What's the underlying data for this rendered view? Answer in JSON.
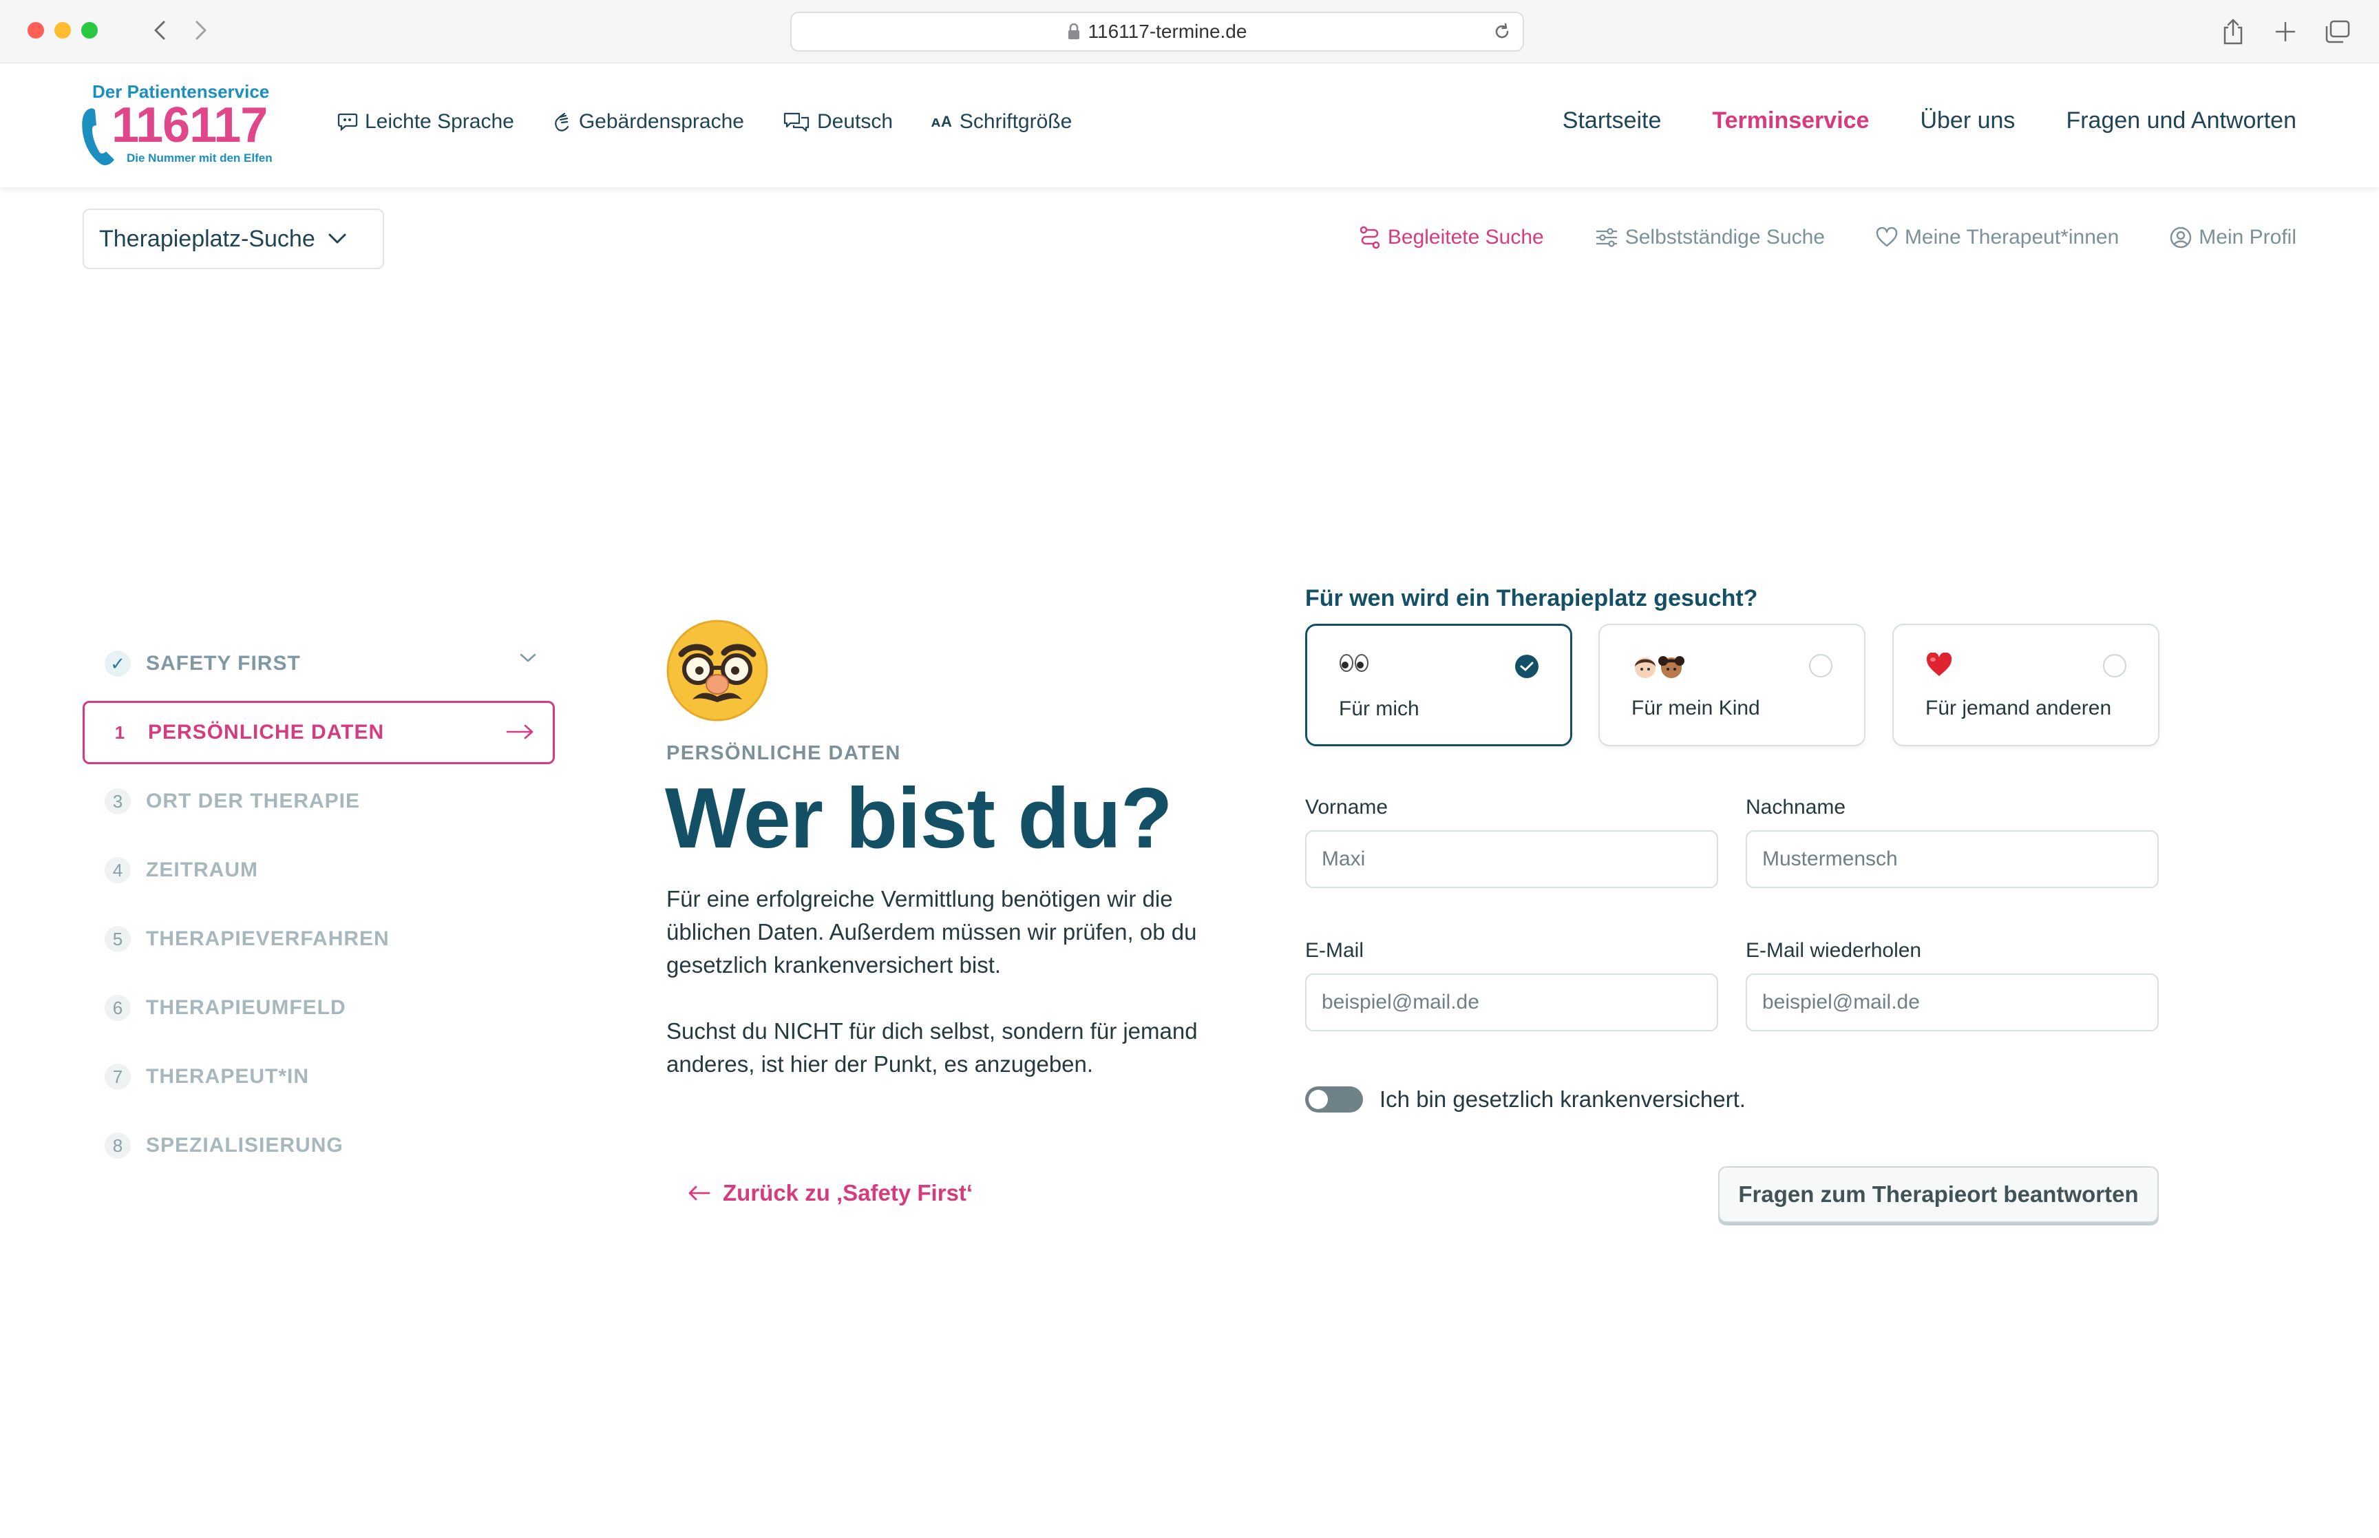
{
  "browser": {
    "url": "116117-termine.de"
  },
  "logo": {
    "top_text": "Der Patientenservice",
    "number": "116117",
    "tagline": "Die Nummer mit den Elfen"
  },
  "access_links": [
    {
      "label": "Leichte Sprache",
      "icon": "speech-bubble-icon"
    },
    {
      "label": "Gebärdensprache",
      "icon": "hand-sign-icon"
    },
    {
      "label": "Deutsch",
      "icon": "language-bubbles-icon"
    },
    {
      "label": "Schriftgröße",
      "icon": "font-size-icon"
    }
  ],
  "main_nav": [
    {
      "label": "Startseite",
      "active": false
    },
    {
      "label": "Terminservice",
      "active": true
    },
    {
      "label": "Über uns",
      "active": false
    },
    {
      "label": "Fragen und Antworten",
      "active": false
    }
  ],
  "sub_select": {
    "label": "Therapieplatz-Suche"
  },
  "sub_nav": [
    {
      "label": "Begleitete Suche",
      "icon": "route-icon",
      "active": true
    },
    {
      "label": "Selbstständige Suche",
      "icon": "sliders-icon",
      "active": false
    },
    {
      "label": "Meine Therapeut*innen",
      "icon": "heart-icon",
      "active": false
    },
    {
      "label": "Mein Profil",
      "icon": "user-circle-icon",
      "active": false
    }
  ],
  "steps": [
    {
      "num": "✓",
      "label": "SAFETY FIRST",
      "state": "done"
    },
    {
      "num": "1",
      "label": "PERSÖNLICHE DATEN",
      "state": "current"
    },
    {
      "num": "3",
      "label": "ORT DER THERAPIE",
      "state": "todo"
    },
    {
      "num": "4",
      "label": "ZEITRAUM",
      "state": "todo"
    },
    {
      "num": "5",
      "label": "THERAPIEVERFAHREN",
      "state": "todo"
    },
    {
      "num": "6",
      "label": "THERAPIEUMFELD",
      "state": "todo"
    },
    {
      "num": "7",
      "label": "THERAPEUT*IN",
      "state": "todo"
    },
    {
      "num": "8",
      "label": "SPEZIALISIERUNG",
      "state": "todo"
    }
  ],
  "content": {
    "emoji": "disguised-face",
    "eyebrow": "PERSÖNLICHE DATEN",
    "headline": "Wer bist du?",
    "paragraph1": "Für eine erfolgreiche Vermittlung benötigen wir die üblichen Daten. Außerdem müssen wir prüfen, ob du gesetzlich krankenversichert bist.",
    "paragraph2": "Suchst du NICHT für dich selbst, sondern für jemand anderes, ist hier der Punkt, es anzugeben.",
    "back_link": "Zurück zu ‚Safety First‘"
  },
  "form": {
    "question": "Für wen wird ein Therapieplatz gesucht?",
    "choices": [
      {
        "label": "Für mich",
        "emoji": "eyes",
        "selected": true
      },
      {
        "label": "Für mein Kind",
        "emoji": "children",
        "selected": false
      },
      {
        "label": "Für jemand anderen",
        "emoji": "red-heart",
        "selected": false
      }
    ],
    "fields": {
      "first_name": {
        "label": "Vorname",
        "placeholder": "Maxi",
        "value": ""
      },
      "last_name": {
        "label": "Nachname",
        "placeholder": "Mustermensch",
        "value": ""
      },
      "email": {
        "label": "E-Mail",
        "placeholder": "beispiel@mail.de",
        "value": ""
      },
      "email_repeat": {
        "label": "E-Mail wiederholen",
        "placeholder": "beispiel@mail.de",
        "value": ""
      }
    },
    "insurance_toggle": {
      "label": "Ich bin gesetzlich krankenversichert.",
      "on": false
    },
    "submit_label": "Fragen zum Therapieort beantworten"
  },
  "colors": {
    "accent": "#d63b7f",
    "primary": "#134f65",
    "muted": "#7b9099"
  }
}
